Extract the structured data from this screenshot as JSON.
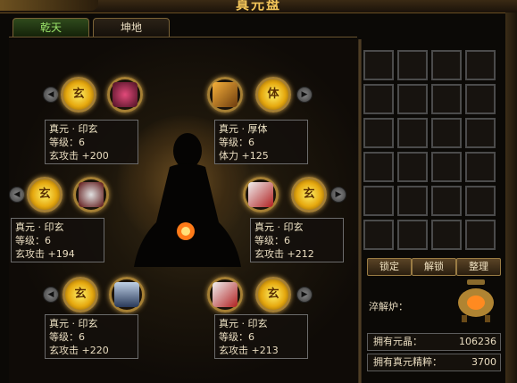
{
  "window": {
    "title": "真元盘"
  },
  "tabs": [
    {
      "label": "乾天",
      "active": true
    },
    {
      "label": "坤地",
      "active": false
    }
  ],
  "nodes": [
    {
      "rune": "玄",
      "name": "真元 · 印玄",
      "level": "等级：6",
      "stat": "玄攻击 +200"
    },
    {
      "rune": "体",
      "name": "真元 · 厚体",
      "level": "等级：6",
      "stat": "体力 +125"
    },
    {
      "rune": "玄",
      "name": "真元 · 印玄",
      "level": "等级：6",
      "stat": "玄攻击 +194"
    },
    {
      "rune": "玄",
      "name": "真元 · 印玄",
      "level": "等级：6",
      "stat": "玄攻击 +212"
    },
    {
      "rune": "玄",
      "name": "真元 · 印玄",
      "level": "等级：6",
      "stat": "玄攻击 +220"
    },
    {
      "rune": "玄",
      "name": "真元 · 印玄",
      "level": "等级：6",
      "stat": "玄攻击 +213"
    }
  ],
  "inventory": {
    "rows": 6,
    "cols": 4
  },
  "buttons": {
    "lock": "锁定",
    "unlock": "解锁",
    "sort": "整理"
  },
  "furnace": {
    "label": "淬解炉：",
    "icon": "furnace-icon"
  },
  "stats": {
    "crystal_label": "拥有元晶：",
    "crystal_value": "106236",
    "essence_label": "拥有真元精粹：",
    "essence_value": "3700"
  },
  "colors": {
    "gold": "#f4c65a",
    "active_tab": "#9be46a",
    "rune": "#f0c020"
  }
}
